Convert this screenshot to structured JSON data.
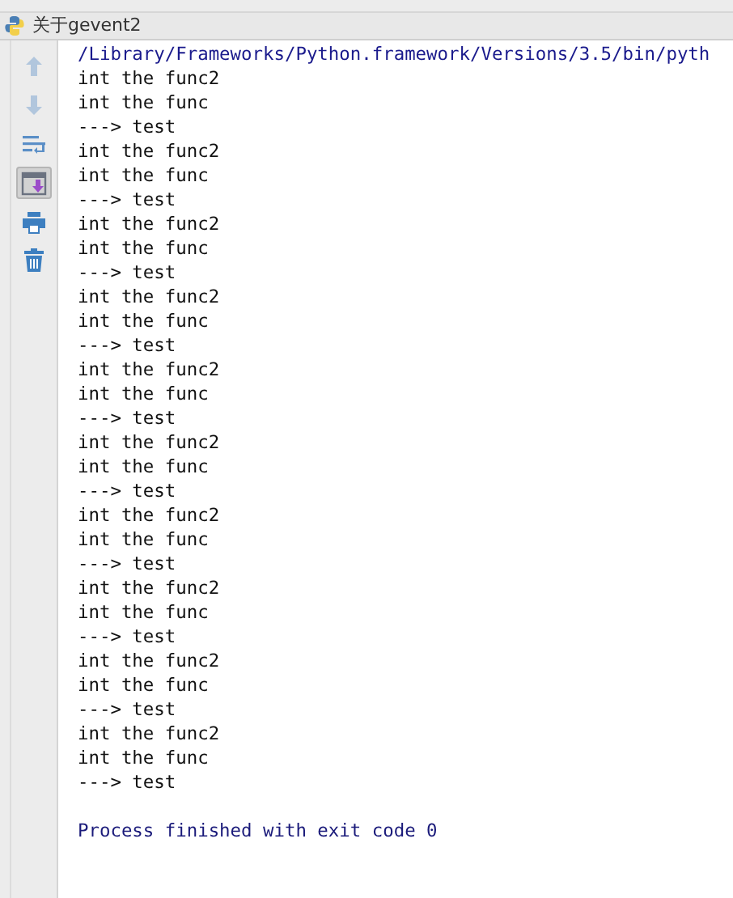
{
  "window": {
    "title": "关于gevent2"
  },
  "toolbar": [
    {
      "kind": "up",
      "disabled": true,
      "selected": false
    },
    {
      "kind": "down",
      "disabled": true,
      "selected": false
    },
    {
      "kind": "wrap",
      "disabled": false,
      "selected": false
    },
    {
      "kind": "scroll",
      "disabled": false,
      "selected": true
    },
    {
      "kind": "print",
      "disabled": false,
      "selected": false
    },
    {
      "kind": "trash",
      "disabled": false,
      "selected": false
    }
  ],
  "console": [
    {
      "kind": "path",
      "text": "/Library/Frameworks/Python.framework/Versions/3.5/bin/pyth"
    },
    {
      "kind": "output",
      "text": "int the func2"
    },
    {
      "kind": "output",
      "text": "int the func"
    },
    {
      "kind": "output",
      "text": "---> test"
    },
    {
      "kind": "output",
      "text": "int the func2"
    },
    {
      "kind": "output",
      "text": "int the func"
    },
    {
      "kind": "output",
      "text": "---> test"
    },
    {
      "kind": "output",
      "text": "int the func2"
    },
    {
      "kind": "output",
      "text": "int the func"
    },
    {
      "kind": "output",
      "text": "---> test"
    },
    {
      "kind": "output",
      "text": "int the func2"
    },
    {
      "kind": "output",
      "text": "int the func"
    },
    {
      "kind": "output",
      "text": "---> test"
    },
    {
      "kind": "output",
      "text": "int the func2"
    },
    {
      "kind": "output",
      "text": "int the func"
    },
    {
      "kind": "output",
      "text": "---> test"
    },
    {
      "kind": "output",
      "text": "int the func2"
    },
    {
      "kind": "output",
      "text": "int the func"
    },
    {
      "kind": "output",
      "text": "---> test"
    },
    {
      "kind": "output",
      "text": "int the func2"
    },
    {
      "kind": "output",
      "text": "int the func"
    },
    {
      "kind": "output",
      "text": "---> test"
    },
    {
      "kind": "output",
      "text": "int the func2"
    },
    {
      "kind": "output",
      "text": "int the func"
    },
    {
      "kind": "output",
      "text": "---> test"
    },
    {
      "kind": "output",
      "text": "int the func2"
    },
    {
      "kind": "output",
      "text": "int the func"
    },
    {
      "kind": "output",
      "text": "---> test"
    },
    {
      "kind": "output",
      "text": "int the func2"
    },
    {
      "kind": "output",
      "text": "int the func"
    },
    {
      "kind": "output",
      "text": "---> test"
    },
    {
      "kind": "exit",
      "text": "Process finished with exit code 0"
    }
  ]
}
